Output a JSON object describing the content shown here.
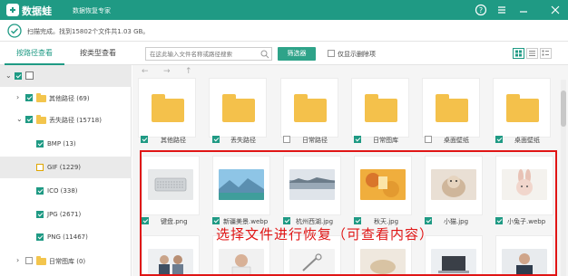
{
  "app": {
    "name": "数据蛙",
    "subtitle": "数据恢复专家"
  },
  "status": {
    "text": "扫描完成。找到15802个文件共1.03 GB。"
  },
  "tabs": [
    {
      "label": "按路径查看",
      "active": true
    },
    {
      "label": "按类型查看",
      "active": false
    }
  ],
  "toolbar": {
    "search_placeholder": "在这此输入文件名称或路径搜索",
    "filter_label": "筛选器",
    "show_deleted_label": "仅显示删除项"
  },
  "sidebar": {
    "items": [
      {
        "label": "其他路径 (69)",
        "checked": true
      },
      {
        "label": "丢失路径 (15718)",
        "checked": true
      },
      {
        "label": "BMP (13)",
        "checked": true
      },
      {
        "label": "GIF (1229)",
        "checked": false
      },
      {
        "label": "ICO (338)",
        "checked": true
      },
      {
        "label": "JPG (2671)",
        "checked": true
      },
      {
        "label": "PNG (11467)",
        "checked": true
      },
      {
        "label": "日常图库 (0)",
        "checked": false
      }
    ]
  },
  "folders": [
    {
      "label": "其他路径",
      "checked": true
    },
    {
      "label": "丢失路径",
      "checked": true
    },
    {
      "label": "日常路径",
      "checked": false
    },
    {
      "label": "日常图库",
      "checked": true
    },
    {
      "label": "桌面壁纸",
      "checked": false
    },
    {
      "label": "桌面壁纸",
      "checked": true
    }
  ],
  "files": [
    {
      "label": "键盘.png",
      "checked": true
    },
    {
      "label": "新疆美景.webp",
      "checked": true
    },
    {
      "label": "杭州西湖.jpg",
      "checked": true
    },
    {
      "label": "秋天.jpg",
      "checked": true
    },
    {
      "label": "小猫.jpg",
      "checked": true
    },
    {
      "label": "小兔子.webp",
      "checked": true
    }
  ],
  "overlay": {
    "annotation": "选择文件进行恢复（可查看内容）"
  },
  "colors": {
    "brand": "#1f9a84",
    "annotation": "#e01515",
    "folder": "#f4c14b"
  }
}
